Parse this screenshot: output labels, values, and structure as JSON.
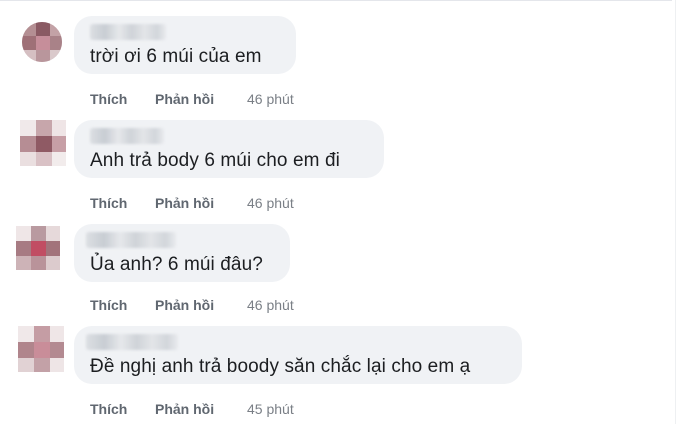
{
  "comments": [
    {
      "text": "trời ơi 6 múi của em",
      "like_label": "Thích",
      "reply_label": "Phản hồi",
      "time": "46 phút"
    },
    {
      "text": "Anh trả body 6 múi cho em đi",
      "like_label": "Thích",
      "reply_label": "Phản hồi",
      "time": "46 phút"
    },
    {
      "text": "Ủa anh? 6 múi đâu?",
      "like_label": "Thích",
      "reply_label": "Phản hồi",
      "time": "46 phút"
    },
    {
      "text": "Đề nghị anh trả boody săn chắc lại cho em ạ",
      "like_label": "Thích",
      "reply_label": "Phản hồi",
      "time": "45 phút"
    }
  ],
  "colors": {
    "bubble": "#f0f2f5",
    "text": "#1c1e21",
    "action": "#606770",
    "time": "#7a7f86"
  }
}
